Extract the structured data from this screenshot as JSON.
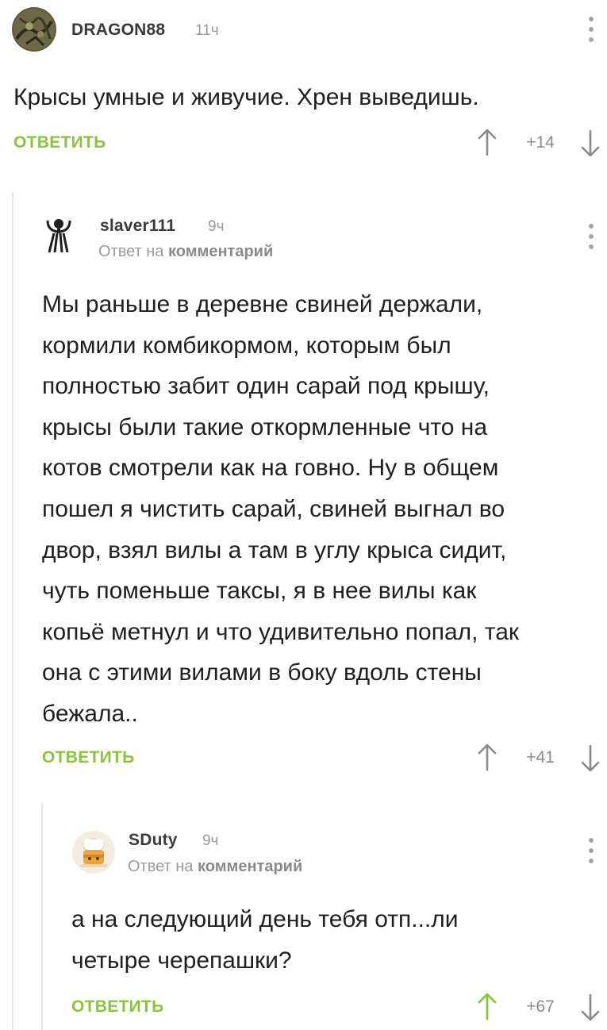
{
  "comments": [
    {
      "username": "DRAGON88",
      "time": "11ч",
      "text": "Крысы умные и живучие. Хрен выведишь.",
      "reply_label": "ОТВЕТИТЬ",
      "rating": "+14",
      "upvote_color": "#8a8a8a"
    },
    {
      "username": "slaver111",
      "time": "9ч",
      "reply_prefix": "Ответ на",
      "reply_target": "комментарий",
      "text": "Мы раньше в деревне свиней держали,\nкормили комбикормом, которым был\nполностью забит один сарай под крышу,\nкрысы были такие откормленные что на\nкотов смотрели как на говно. Ну в общем\nпошел я чистить сарай, свиней выгнал во\nдвор, взял вилы а там в углу крыса сидит,\nчуть поменьше таксы, я в нее вилы как\nкопьё метнул и что удивительно попал, так\nона с этими вилами в боку вдоль стены\nбежала..",
      "reply_label": "ОТВЕТИТЬ",
      "rating": "+41",
      "upvote_color": "#8a8a8a"
    },
    {
      "username": "SDuty",
      "time": "9ч",
      "reply_prefix": "Ответ на",
      "reply_target": "комментарий",
      "text": "а на следующий день тебя отп...ли\nчетыре черепашки?",
      "reply_label": "ОТВЕТИТЬ",
      "rating": "+67",
      "upvote_color": "#8ac43f"
    }
  ],
  "colors": {
    "accent": "#8ac43f",
    "muted": "#9a9a9a",
    "thread_line": "#e6e6e6",
    "text": "#1f1f1f"
  },
  "icons": {
    "more": "vertical-dots-icon",
    "upvote": "arrow-up-icon",
    "downvote": "arrow-down-icon"
  }
}
